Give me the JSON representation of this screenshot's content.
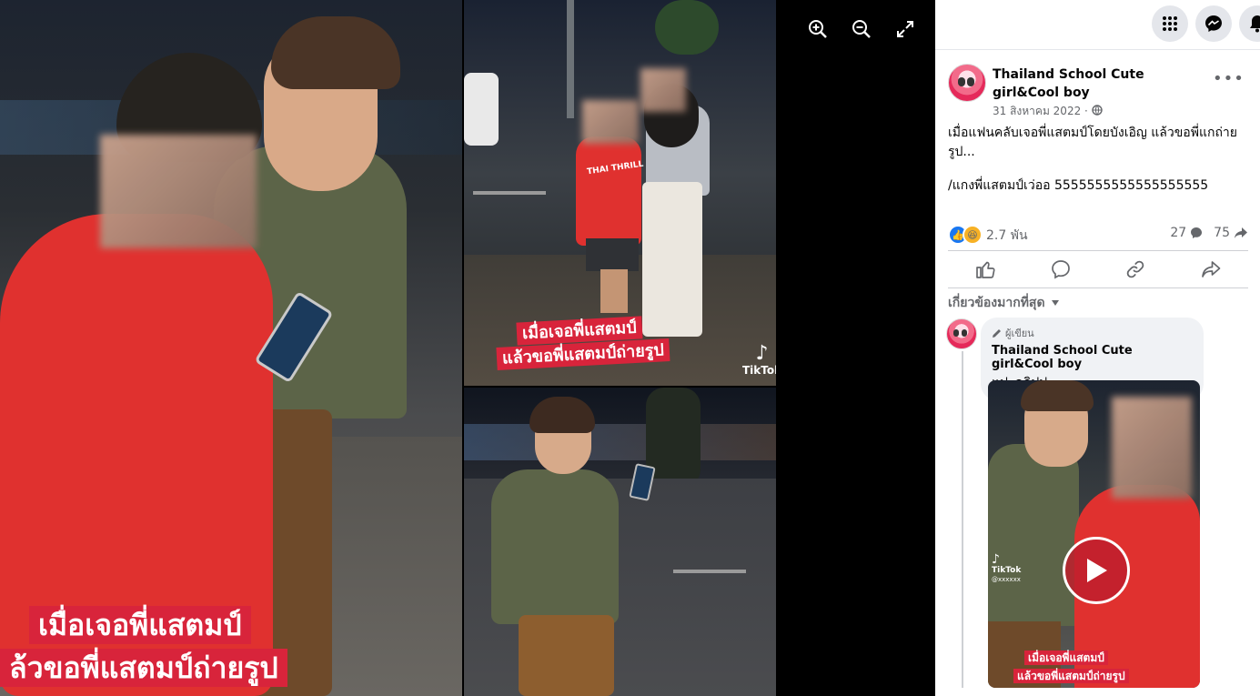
{
  "viewer": {
    "captions": {
      "left_line1": "เมื่อเจอพี่แสตมป์",
      "left_line2": "ล้วขอพี่แสตมป์ถ่ายรูป",
      "topright_line1": "เมื่อเจอพี่แสตมป์",
      "topright_line2": "แล้วขอพี่แสตมป์ถ่ายรูป"
    },
    "tiktok_label": "TikTok",
    "shirt_text": "THAI THRILL",
    "tools": [
      "zoom-in-icon",
      "zoom-out-icon",
      "fullscreen-icon"
    ]
  },
  "topbar": {
    "icons": [
      "menu-grid-icon",
      "messenger-icon",
      "notifications-icon"
    ]
  },
  "post": {
    "page_name": "Thailand School Cute girl&Cool boy",
    "date": "31 สิงหาคม 2022 ·",
    "text_line1": "เมื่อแฟนคลับเจอพี่แสตมป์โดยบังเอิญ แล้วขอพี่แกถ่ายรูป...",
    "text_line2": "/แกงพี่แสตมป์เว่ออ 5555555555555555555",
    "reactions_count": "2.7 พัน",
    "comments_count": "27",
    "shares_count": "75"
  },
  "comments": {
    "sort_label": "เกี่ยวข้องมากที่สุด",
    "items": [
      {
        "badge": "ผู้เขียน",
        "author": "Thailand School Cute girl&Cool boy",
        "text": "แปะคลิปป",
        "video": {
          "tiktok": "TikTok",
          "handle": "@xxxxxx",
          "caption_line1": "เมื่อเจอพี่แสตมป์",
          "caption_line2": "แล้วขอพี่แสตมป์ถ่ายรูป"
        }
      }
    ]
  },
  "colors": {
    "caption_red": "#d8243b",
    "fb_blue": "#1877f2",
    "shirt_red": "#e0312f",
    "shirt_green": "#5c6448"
  }
}
